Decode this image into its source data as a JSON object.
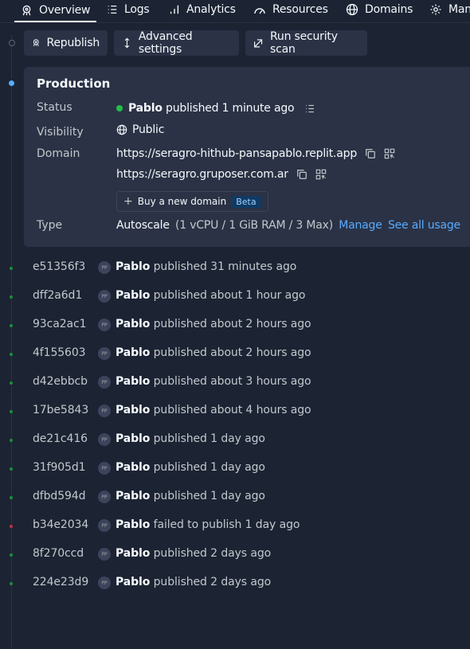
{
  "tabs": [
    {
      "label": "Overview",
      "icon": "rocket-icon",
      "active": true
    },
    {
      "label": "Logs",
      "icon": "list-icon"
    },
    {
      "label": "Analytics",
      "icon": "bar-chart-icon"
    },
    {
      "label": "Resources",
      "icon": "gauge-icon"
    },
    {
      "label": "Domains",
      "icon": "globe-icon"
    },
    {
      "label": "Man",
      "icon": "gear-icon"
    }
  ],
  "actions": {
    "republish": "Republish",
    "advanced": "Advanced settings",
    "security": "Run security scan"
  },
  "production": {
    "title": "Production",
    "status_label": "Status",
    "status_user": "Pablo",
    "status_text": "published 1 minute ago",
    "status_color": "#1fbf4a",
    "visibility_label": "Visibility",
    "visibility_value": "Public",
    "domain_label": "Domain",
    "domains": [
      "https://seragro-hithub-pansapablo.replit.app",
      "https://seragro.gruposer.com.ar"
    ],
    "buy_domain": "Buy a new domain",
    "beta": "Beta",
    "type_label": "Type",
    "type_value": "Autoscale",
    "type_detail": "(1 vCPU / 1 GiB RAM / 3 Max)",
    "manage": "Manage",
    "see_all": "See all usage"
  },
  "history": [
    {
      "hash": "e51356f3",
      "user": "Pablo",
      "text": "published 31 minutes ago",
      "status": "success"
    },
    {
      "hash": "dff2a6d1",
      "user": "Pablo",
      "text": "published about 1 hour ago",
      "status": "success"
    },
    {
      "hash": "93ca2ac1",
      "user": "Pablo",
      "text": "published about 2 hours ago",
      "status": "success"
    },
    {
      "hash": "4f155603",
      "user": "Pablo",
      "text": "published about 2 hours ago",
      "status": "success"
    },
    {
      "hash": "d42ebbcb",
      "user": "Pablo",
      "text": "published about 3 hours ago",
      "status": "success"
    },
    {
      "hash": "17be5843",
      "user": "Pablo",
      "text": "published about 4 hours ago",
      "status": "success"
    },
    {
      "hash": "de21c416",
      "user": "Pablo",
      "text": "published 1 day ago",
      "status": "success"
    },
    {
      "hash": "31f905d1",
      "user": "Pablo",
      "text": "published 1 day ago",
      "status": "success"
    },
    {
      "hash": "dfbd594d",
      "user": "Pablo",
      "text": "published 1 day ago",
      "status": "success"
    },
    {
      "hash": "b34e2034",
      "user": "Pablo",
      "text": "failed to publish 1 day ago",
      "status": "failed"
    },
    {
      "hash": "8f270ccd",
      "user": "Pablo",
      "text": "published 2 days ago",
      "status": "success"
    },
    {
      "hash": "224e23d9",
      "user": "Pablo",
      "text": "published 2 days ago",
      "status": "success"
    }
  ],
  "avatar_initials": "PP",
  "colors": {
    "success": "#1a8f38",
    "failed": "#c2313f",
    "accent": "#57abff",
    "active_dot": "#57abff"
  }
}
